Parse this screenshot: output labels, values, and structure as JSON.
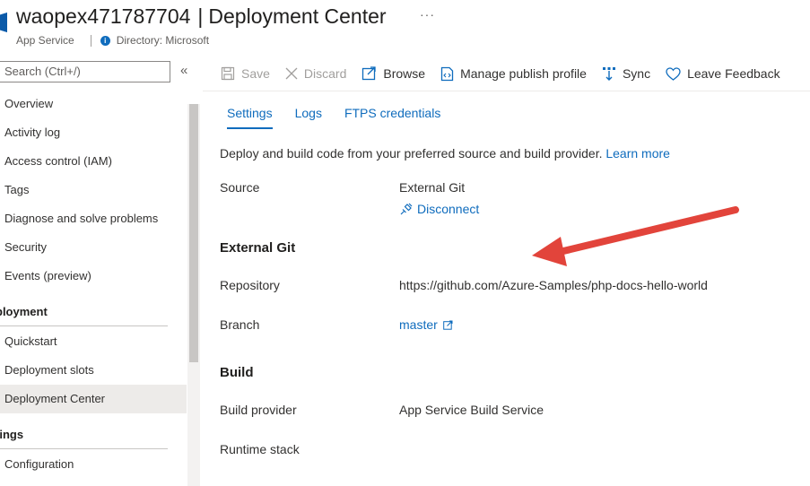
{
  "header": {
    "resource_name": "waopex471787704",
    "separator": "|",
    "page_name": "Deployment Center",
    "more": "···",
    "resource_type": "App Service",
    "directory": "Directory: Microsoft"
  },
  "sidebar": {
    "search_placeholder": "Search (Ctrl+/)",
    "collapse": "«",
    "items": [
      {
        "label": "Overview"
      },
      {
        "label": "Activity log"
      },
      {
        "label": "Access control (IAM)"
      },
      {
        "label": "Tags"
      },
      {
        "label": "Diagnose and solve problems"
      },
      {
        "label": "Security"
      },
      {
        "label": "Events (preview)"
      }
    ],
    "deployment_section": "ployment",
    "deployment_items": [
      {
        "label": "Quickstart"
      },
      {
        "label": "Deployment slots"
      },
      {
        "label": "Deployment Center",
        "selected": true
      }
    ],
    "settings_section": "tings",
    "settings_items": [
      {
        "label": "Configuration"
      }
    ]
  },
  "toolbar": {
    "save": "Save",
    "discard": "Discard",
    "browse": "Browse",
    "manage_publish_profile": "Manage publish profile",
    "sync": "Sync",
    "leave_feedback": "Leave Feedback"
  },
  "tabs": [
    {
      "label": "Settings",
      "active": true
    },
    {
      "label": "Logs"
    },
    {
      "label": "FTPS credentials"
    }
  ],
  "content": {
    "description": "Deploy and build code from your preferred source and build provider.",
    "learn_more": "Learn more",
    "source_label": "Source",
    "source_value": "External Git",
    "disconnect": "Disconnect",
    "external_git_heading": "External Git",
    "repository_label": "Repository",
    "repository_value": "https://github.com/Azure-Samples/php-docs-hello-world",
    "branch_label": "Branch",
    "branch_value": "master",
    "build_heading": "Build",
    "build_provider_label": "Build provider",
    "build_provider_value": "App Service Build Service",
    "runtime_stack_label": "Runtime stack"
  },
  "colors": {
    "accent": "#0f6cbd",
    "annotation_arrow": "#e2443b",
    "selected_bg": "#edebe9"
  }
}
